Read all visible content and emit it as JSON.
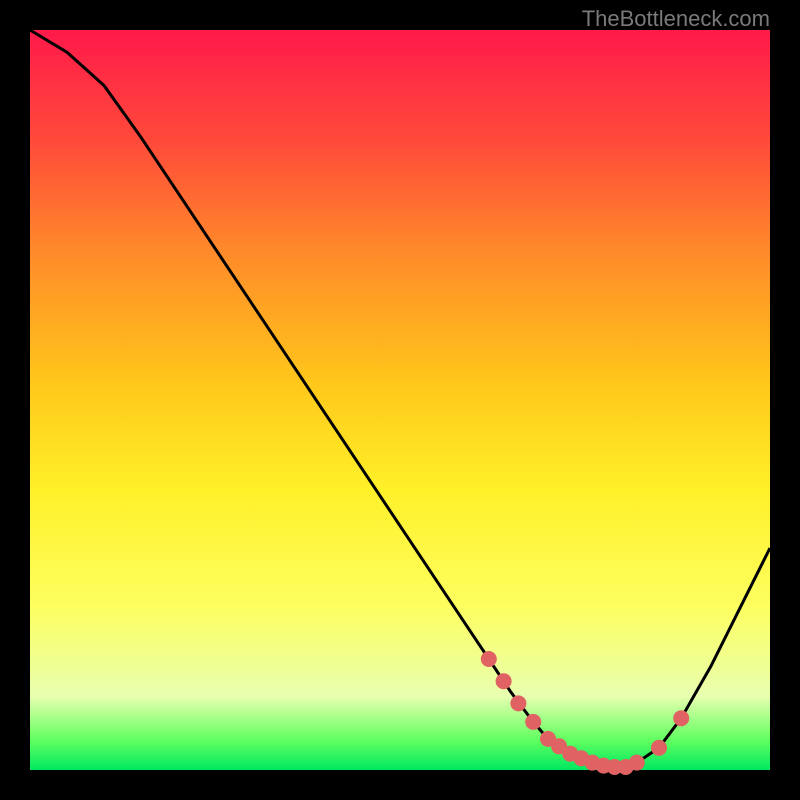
{
  "watermark": "TheBottleneck.com",
  "chart_data": {
    "type": "line",
    "title": "",
    "xlabel": "",
    "ylabel": "",
    "xlim": [
      0,
      100
    ],
    "ylim": [
      0,
      100
    ],
    "series": [
      {
        "name": "curve",
        "x": [
          0,
          5,
          10,
          15,
          20,
          25,
          30,
          35,
          40,
          45,
          50,
          55,
          60,
          62,
          65,
          68,
          70,
          72,
          74,
          76,
          78,
          80,
          82,
          85,
          88,
          92,
          96,
          100
        ],
        "values": [
          100,
          97,
          92.5,
          85.5,
          78,
          70.5,
          63,
          55.5,
          48,
          40.5,
          33,
          25.5,
          18,
          15,
          10.5,
          6.5,
          4.2,
          2.5,
          1.3,
          0.6,
          0.3,
          0.4,
          1.0,
          3,
          7,
          14,
          22,
          30
        ]
      },
      {
        "name": "markers",
        "x": [
          62,
          64,
          66,
          68,
          70,
          71.5,
          73,
          74.5,
          76,
          77.5,
          79,
          80.5,
          82,
          85,
          88
        ],
        "values": [
          15,
          12,
          9,
          6.5,
          4.2,
          3.2,
          2.2,
          1.6,
          1.0,
          0.6,
          0.4,
          0.4,
          1.0,
          3.0,
          7.0
        ]
      }
    ],
    "gradient": {
      "colors": [
        "#ff1a4a",
        "#ff4a3a",
        "#ff8a2a",
        "#ffc81a",
        "#fff028",
        "#fdff60",
        "#e8ffb0",
        "#60ff60",
        "#00e860"
      ],
      "stops": [
        0,
        0.15,
        0.3,
        0.48,
        0.62,
        0.78,
        0.9,
        0.96,
        1.0
      ]
    },
    "marker": {
      "color": "#e06262",
      "radius": 8
    }
  }
}
